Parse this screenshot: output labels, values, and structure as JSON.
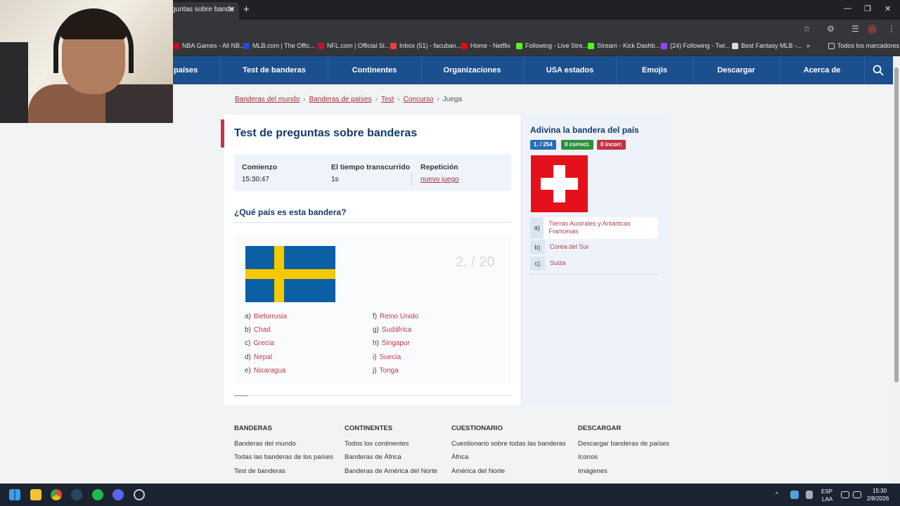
{
  "browser": {
    "tab_title": "guntas sobre bande",
    "tab_close": "✕",
    "new_tab": "+",
    "bookmarks": [
      {
        "label": "NBA Games - All NB...",
        "color": "#c9082a"
      },
      {
        "label": "MLB.com | The Offic...",
        "color": "#1d4ed8"
      },
      {
        "label": "NFL.com | Official Si...",
        "color": "#c8102e"
      },
      {
        "label": "Inbox (51) - facuban...",
        "color": "#ea4335"
      },
      {
        "label": "Home - Netflix",
        "color": "#e50914"
      },
      {
        "label": "Following - Live Stre...",
        "color": "#53fc18"
      },
      {
        "label": "Stream - Kick Dashb...",
        "color": "#53fc18"
      },
      {
        "label": "(24) Following - Twi...",
        "color": "#9146ff"
      },
      {
        "label": "Best Fantasy MLB -...",
        "color": "#dddddd"
      }
    ],
    "bookmarks_more": "»",
    "all_bookmarks": "Todos los marcadores"
  },
  "nav": {
    "items": [
      "países",
      "Test de banderas",
      "Continentes",
      "Organizaciones",
      "USA estados",
      "Emojis",
      "Descargar",
      "Acerca de"
    ]
  },
  "breadcrumb": {
    "items": [
      "Banderas del mundo",
      "Banderas de países",
      "Test",
      "Concurso"
    ],
    "current": "Juega",
    "sep": "›"
  },
  "quiz": {
    "title": "Test de preguntas sobre banderas",
    "start_label": "Comienzo",
    "start_value": "15:30:47",
    "elapsed_label": "El tiempo transcurrido",
    "elapsed_value": "1s",
    "repeat_label": "Repetición",
    "repeat_link": "nuevo juego",
    "question": "¿Qué país es esta bandera?",
    "counter": "2. / 20",
    "options_left": [
      {
        "key": "a)",
        "label": "Bielorrusia"
      },
      {
        "key": "b)",
        "label": "Chad"
      },
      {
        "key": "c)",
        "label": "Grecia"
      },
      {
        "key": "d)",
        "label": "Nepal"
      },
      {
        "key": "e)",
        "label": "Nicaragua"
      }
    ],
    "options_right": [
      {
        "key": "f)",
        "label": "Reino Unido"
      },
      {
        "key": "g)",
        "label": "Sudáfrica"
      },
      {
        "key": "h)",
        "label": "Singapur"
      },
      {
        "key": "i)",
        "label": "Suecia"
      },
      {
        "key": "j)",
        "label": "Tonga"
      }
    ]
  },
  "side": {
    "title": "Adivina la bandera del país",
    "badges": [
      {
        "label": "1.  / 254",
        "color": "#2a6db5"
      },
      {
        "label": "0  correct.",
        "color": "#2f8f3c"
      },
      {
        "label": "0  incorr.",
        "color": "#c23342"
      }
    ],
    "options": [
      {
        "key": "a)",
        "label": "Tierras Australes y Antárticas Francesas"
      },
      {
        "key": "b)",
        "label": "Corea del Sur"
      },
      {
        "key": "c)",
        "label": "Suiza"
      }
    ]
  },
  "footer": {
    "columns": [
      {
        "heading": "BANDERAS",
        "links": [
          "Banderas del mundo",
          "Todas las banderas de los países",
          "Test de banderas"
        ]
      },
      {
        "heading": "CONTINENTES",
        "links": [
          "Todos los continentes",
          "Banderas de África",
          "Banderas de América del Norte"
        ]
      },
      {
        "heading": "CUESTIONARIO",
        "links": [
          "Cuestionario sobre todas las banderas",
          "África",
          "América del Norte"
        ]
      },
      {
        "heading": "DESCARGAR",
        "links": [
          "Descargar banderas de países",
          "Iconos",
          "Imágenes"
        ]
      }
    ]
  },
  "taskbar": {
    "lang": "ESP",
    "lang2": "LAA",
    "time": "15:30",
    "date": "2/8/2026",
    "chevron": "^"
  }
}
